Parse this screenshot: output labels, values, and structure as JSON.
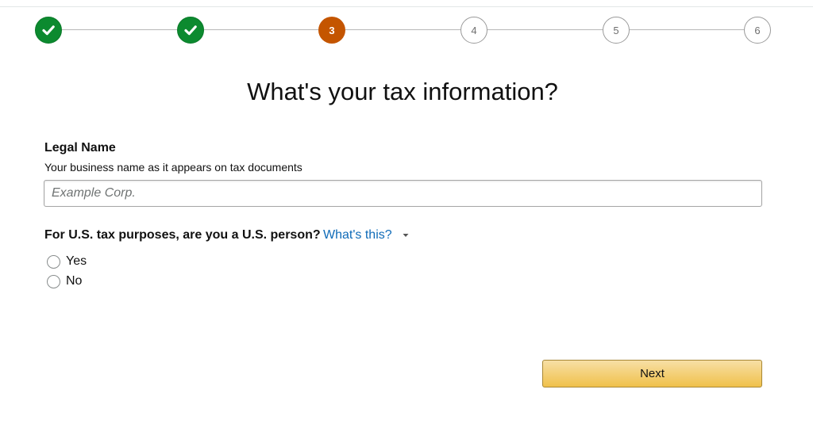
{
  "stepper": {
    "steps": [
      {
        "state": "done",
        "label": ""
      },
      {
        "state": "done",
        "label": ""
      },
      {
        "state": "current",
        "label": "3"
      },
      {
        "state": "future",
        "label": "4"
      },
      {
        "state": "future",
        "label": "5"
      },
      {
        "state": "future",
        "label": "6"
      }
    ],
    "done_color": "#0c8a2f",
    "current_color": "#c45500",
    "check_icon": "checkmark-icon"
  },
  "page": {
    "title": "What's your tax information?"
  },
  "legal_name": {
    "label": "Legal Name",
    "hint": "Your business name as it appears on tax documents",
    "placeholder": "Example Corp.",
    "value": ""
  },
  "us_person": {
    "question": "For U.S. tax purposes, are you a U.S. person?",
    "help_link": "What's this?",
    "help_icon": "caret-down-icon",
    "options": [
      {
        "label": "Yes",
        "selected": false
      },
      {
        "label": "No",
        "selected": false
      }
    ]
  },
  "actions": {
    "next_label": "Next",
    "button_color": "#f0c14b"
  }
}
